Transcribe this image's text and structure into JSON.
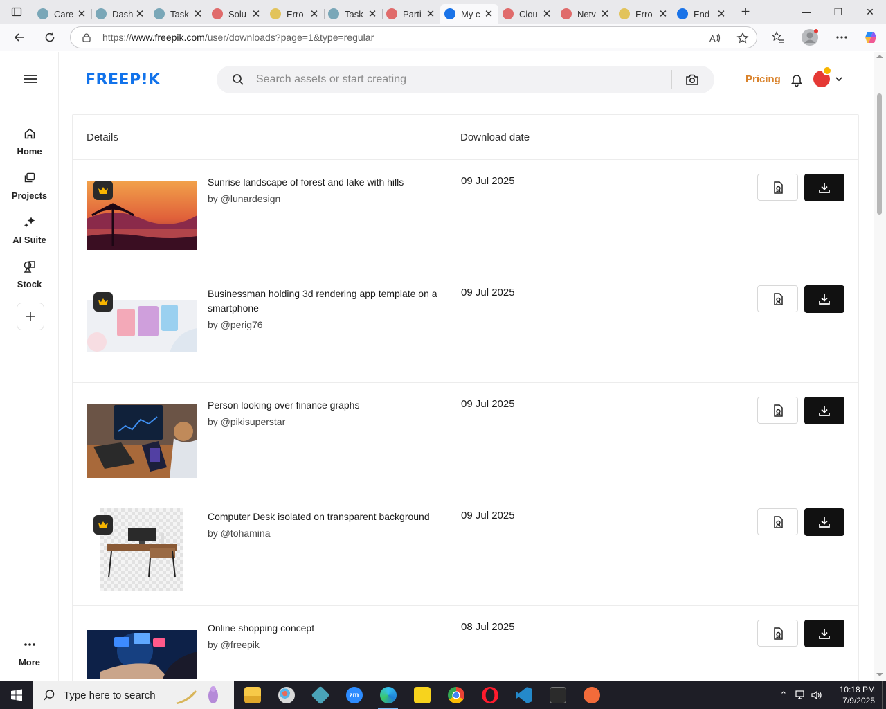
{
  "browser": {
    "tabs": [
      {
        "title": "Care",
        "favicon_color": "#7aa7b8",
        "active": false
      },
      {
        "title": "Dash",
        "favicon_color": "#7aa7b8",
        "active": false
      },
      {
        "title": "Task",
        "favicon_color": "#7aa7b8",
        "active": false
      },
      {
        "title": "Solu",
        "favicon_color": "#e06b6b",
        "active": false
      },
      {
        "title": "Erro",
        "favicon_color": "#e2c35a",
        "active": false
      },
      {
        "title": "Task",
        "favicon_color": "#7aa7b8",
        "active": false
      },
      {
        "title": "Parti",
        "favicon_color": "#e06b6b",
        "active": false
      },
      {
        "title": "My c",
        "favicon_color": "#1a73e8",
        "active": true
      },
      {
        "title": "Clou",
        "favicon_color": "#e06b6b",
        "active": false
      },
      {
        "title": "Netv",
        "favicon_color": "#e06b6b",
        "active": false
      },
      {
        "title": "Erro",
        "favicon_color": "#e2c35a",
        "active": false
      },
      {
        "title": "End",
        "favicon_color": "#1a73e8",
        "active": false
      }
    ],
    "url_prefix": "https://",
    "url_host": "www.freepik.com",
    "url_path": "/user/downloads?page=1&type=regular"
  },
  "rail": {
    "items": [
      {
        "label": "Home",
        "icon": "home-icon"
      },
      {
        "label": "Projects",
        "icon": "projects-icon"
      },
      {
        "label": "AI Suite",
        "icon": "ai-suite-icon"
      },
      {
        "label": "Stock",
        "icon": "stock-icon"
      }
    ],
    "more_label": "More"
  },
  "header": {
    "logo": "FREEP!K",
    "search_placeholder": "Search assets or start creating",
    "pricing_label": "Pricing"
  },
  "table": {
    "col_details": "Details",
    "col_date": "Download date",
    "rows": [
      {
        "title": "Sunrise landscape of forest and lake with hills",
        "author": "by @lunardesign",
        "date": "09 Jul 2025",
        "thumb": "sunset",
        "premium": true
      },
      {
        "title": "Businessman holding 3d rendering app template on a smartphone",
        "author": "by @perig76",
        "date": "09 Jul 2025",
        "thumb": "app",
        "premium": true
      },
      {
        "title": "Person looking over finance graphs",
        "author": "by @pikisuperstar",
        "date": "09 Jul 2025",
        "thumb": "finance",
        "premium": false
      },
      {
        "title": "Computer Desk isolated on transparent background",
        "author": "by @tohamina",
        "date": "09 Jul 2025",
        "thumb": "desk",
        "premium": true
      },
      {
        "title": "Online shopping concept",
        "author": "by @freepik",
        "date": "08 Jul 2025",
        "thumb": "shopping",
        "premium": false
      }
    ]
  },
  "taskbar": {
    "search_placeholder": "Type here to search",
    "time": "10:18 PM",
    "date": "7/9/2025"
  },
  "colors": {
    "brand": "#1273eb",
    "pricing": "#d9822b",
    "download_button": "#111111"
  }
}
